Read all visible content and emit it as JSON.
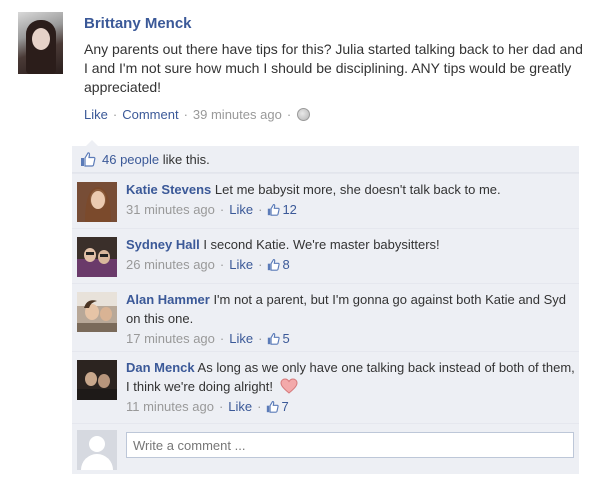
{
  "post": {
    "author": "Brittany Menck",
    "text": "Any parents out there have tips for this? Julia started talking back to her dad and I and I'm not sure how much I should be disciplining. ANY tips would be greatly appreciated!",
    "like_label": "Like",
    "comment_label": "Comment",
    "time": "39 minutes ago",
    "privacy_icon": "globe-icon"
  },
  "likes": {
    "count_text": "46 people",
    "suffix": " like this."
  },
  "comments": [
    {
      "author": "Katie Stevens",
      "text": "Let me babysit more, she doesn't talk back to me.",
      "time": "31 minutes ago",
      "like_label": "Like",
      "likes": "12"
    },
    {
      "author": "Sydney Hall",
      "text": "I second Katie. We're master babysitters!",
      "time": "26 minutes ago",
      "like_label": "Like",
      "likes": "8"
    },
    {
      "author": "Alan Hammer",
      "text": "I'm not a parent, but I'm gonna go against both Katie and Syd on this one.",
      "time": "17 minutes ago",
      "like_label": "Like",
      "likes": "5"
    },
    {
      "author": "Dan Menck",
      "text": "As long as we only have one talking back instead of both of them, I think we're doing alright!",
      "time": "11 minutes ago",
      "like_label": "Like",
      "likes": "7",
      "emoji": "heart-icon"
    }
  ],
  "composer": {
    "placeholder": "Write a comment ..."
  },
  "colors": {
    "link": "#3b5998",
    "panel": "#edeff4",
    "meta": "#999999"
  }
}
